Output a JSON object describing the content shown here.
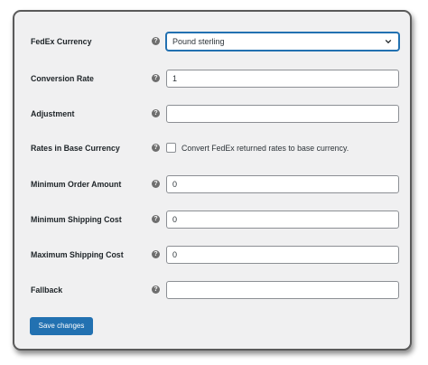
{
  "settings": {
    "currency": {
      "label": "FedEx Currency",
      "help_icon": "question-circle-icon",
      "value": "Pound sterling",
      "chevron_icon": "chevron-down-icon"
    },
    "conversion_rate": {
      "label": "Conversion Rate",
      "value": "1"
    },
    "adjustment": {
      "label": "Adjustment",
      "value": ""
    },
    "base_currency": {
      "label": "Rates in Base Currency",
      "checked": false,
      "checkbox_label": "Convert FedEx returned rates to base currency."
    },
    "min_order": {
      "label": "Minimum Order Amount",
      "value": "0"
    },
    "min_shipping": {
      "label": "Minimum Shipping Cost",
      "value": "0"
    },
    "max_shipping": {
      "label": "Maximum Shipping Cost",
      "value": "0"
    },
    "fallback": {
      "label": "Fallback",
      "value": ""
    }
  },
  "actions": {
    "save_label": "Save changes"
  },
  "help_glyph": "?",
  "colors": {
    "accent": "#2271b1",
    "panel_bg": "#f0f0f1",
    "text": "#1d2327",
    "help_icon": "#6e6e6e"
  }
}
